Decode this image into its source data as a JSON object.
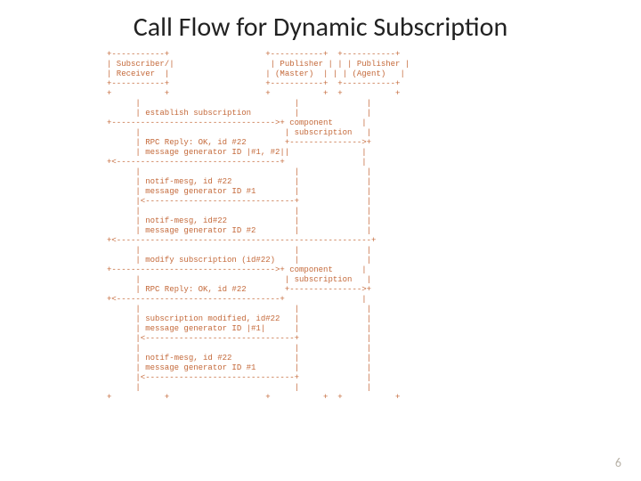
{
  "slide": {
    "title": "Call Flow for Dynamic Subscription",
    "page_number": "6"
  },
  "diagram": {
    "actors": {
      "subscriber": "Subscriber/\nReceiver",
      "publisher_master": "Publisher\n(Master)",
      "publisher_agent": "Publisher\n(Agent)"
    },
    "messages": [
      "establish subscription",
      "component subscription",
      "RPC Reply: OK, id #22",
      "message generator ID |#1, #2|",
      "notif-mesg, id #22",
      "message generator ID #1",
      "notif-mesg, id#22",
      "message generator ID #2",
      "modify subscription (id#22)",
      "component subscription",
      "RPC Reply: OK, id #22",
      "subscription modified, id#22",
      "message generator ID |#1|",
      "notif-mesg, id #22",
      "message generator ID #1"
    ],
    "ascii": "+-----------+                    +-----------+  +-----------+\n| Subscriber/|                    | Publisher | | | Publisher |\n| Receiver  |                    | (Master)  | | | (Agent)   |\n+-----------+                    +-----------+  +-----------+\n+           +                    +           +  +           +\n      |                                |              |\n      | establish subscription         |              |\n+---------------------------------->+ component      |\n      |                              | subscription   |\n      | RPC Reply: OK, id #22        +--------------->+\n      | message generator ID |#1, #2||               |\n+<----------------------------------+                |\n      |                                |              |\n      | notif-mesg, id #22             |              |\n      | message generator ID #1        |              |\n      |<-------------------------------+              |\n      |                                |              |\n      | notif-mesg, id#22              |              |\n      | message generator ID #2        |              |\n+<-----------------------------------------------------+\n      |                                |              |\n      | modify subscription (id#22)    |              |\n+---------------------------------->+ component      |\n      |                              | subscription   |\n      | RPC Reply: OK, id #22        +--------------->+\n+<----------------------------------+                |\n      |                                |              |\n      | subscription modified, id#22   |              |\n      | message generator ID |#1|      |              |\n      |<-------------------------------+              |\n      |                                |              |\n      | notif-mesg, id #22             |              |\n      | message generator ID #1        |              |\n      |<-------------------------------+              |\n      |                                |              |\n+           +                    +           +  +           +"
  }
}
